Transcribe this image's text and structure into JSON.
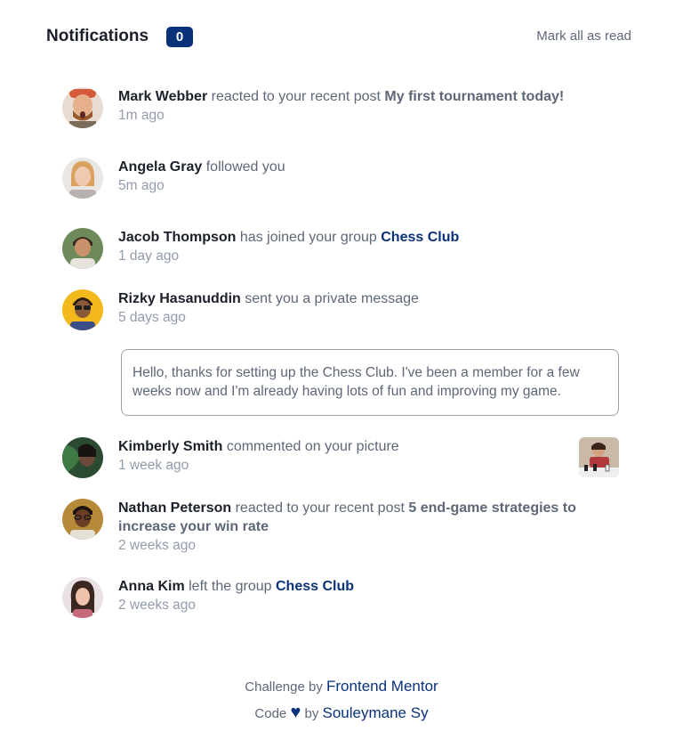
{
  "header": {
    "title": "Notifications",
    "unread_count": "0",
    "mark_all_label": "Mark all as read"
  },
  "notifications": [
    {
      "name": "Mark Webber",
      "action": "reacted to your recent post",
      "target": "My first tournament today!",
      "target_type": "post",
      "time": "1m ago",
      "avatar_icon": "avatar-mark-webber"
    },
    {
      "name": "Angela Gray",
      "action": "followed you",
      "target": "",
      "target_type": "none",
      "time": "5m ago",
      "avatar_icon": "avatar-angela-gray"
    },
    {
      "name": "Jacob Thompson",
      "action": "has joined your group",
      "target": "Chess Club",
      "target_type": "group",
      "time": "1 day ago",
      "avatar_icon": "avatar-jacob-thompson"
    },
    {
      "name": "Rizky Hasanuddin",
      "action": "sent you a private message",
      "target": "",
      "target_type": "none",
      "time": "5 days ago",
      "avatar_icon": "avatar-rizky-hasanuddin",
      "message": "Hello, thanks for setting up the Chess Club. I've been a member for a few weeks now and I'm already having lots of fun and improving my game."
    },
    {
      "name": "Kimberly Smith",
      "action": "commented on your picture",
      "target": "",
      "target_type": "none",
      "time": "1 week ago",
      "avatar_icon": "avatar-kimberly-smith",
      "picture_icon": "chess-picture-thumbnail"
    },
    {
      "name": "Nathan Peterson",
      "action": "reacted to your recent post",
      "target": "5 end-game strategies to increase your win rate",
      "target_type": "post",
      "time": "2 weeks ago",
      "avatar_icon": "avatar-nathan-peterson"
    },
    {
      "name": "Anna Kim",
      "action": "left the group",
      "target": "Chess Club",
      "target_type": "group",
      "time": "2 weeks ago",
      "avatar_icon": "avatar-anna-kim"
    }
  ],
  "footer": {
    "challenge_prefix": "Challenge by",
    "challenge_link": "Frontend Mentor",
    "code_prefix": "Code",
    "heart_icon": "heart-icon",
    "by": "by",
    "author_link": "Souleymane Sy"
  },
  "colors": {
    "badge": "#0a327b",
    "group_link": "#0a327b",
    "name": "#1c202b",
    "text": "#5e6778",
    "time": "#939cad"
  }
}
